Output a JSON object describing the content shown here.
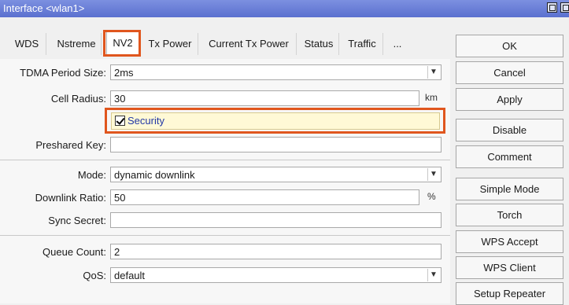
{
  "window": {
    "title": "Interface <wlan1>"
  },
  "tabs": [
    "WDS",
    "Nstreme",
    "NV2",
    "Tx Power",
    "Current Tx Power",
    "Status",
    "Traffic",
    "..."
  ],
  "form": {
    "tdma_label": "TDMA Period Size:",
    "tdma_value": "2ms",
    "cell_radius_label": "Cell Radius:",
    "cell_radius_value": "30",
    "cell_radius_unit": "km",
    "security_label": "Security",
    "security_checked": true,
    "preshared_label": "Preshared Key:",
    "preshared_value": "",
    "mode_label": "Mode:",
    "mode_value": "dynamic downlink",
    "downlink_label": "Downlink Ratio:",
    "downlink_value": "50",
    "downlink_unit": "%",
    "sync_label": "Sync Secret:",
    "sync_value": "",
    "queue_label": "Queue Count:",
    "queue_value": "2",
    "qos_label": "QoS:",
    "qos_value": "default"
  },
  "buttons": {
    "ok": "OK",
    "cancel": "Cancel",
    "apply": "Apply",
    "disable": "Disable",
    "comment": "Comment",
    "simple_mode": "Simple Mode",
    "torch": "Torch",
    "wps_accept": "WPS Accept",
    "wps_client": "WPS Client",
    "setup_repeater": "Setup Repeater"
  },
  "colors": {
    "titlebar": "#6b7fd8",
    "highlight": "#e0561e",
    "security_text": "#2238a6"
  }
}
